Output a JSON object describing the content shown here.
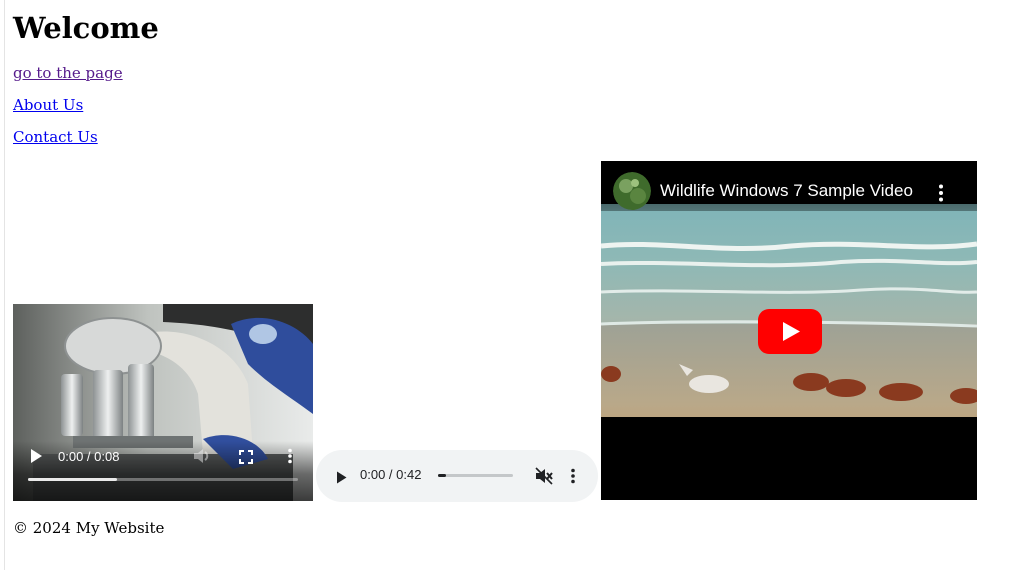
{
  "page": {
    "heading": "Welcome",
    "links": [
      {
        "label": "go to the page",
        "state": "visited"
      },
      {
        "label": "About Us",
        "state": "unvisited"
      },
      {
        "label": "Contact Us",
        "state": "unvisited"
      }
    ],
    "footer": "© 2024 My Website"
  },
  "video_player": {
    "time_display": "0:00 / 0:08",
    "buffered_fraction": 0.33,
    "icons": [
      "play-icon",
      "volume-icon",
      "fullscreen-icon",
      "more-vert-icon"
    ]
  },
  "audio_player": {
    "time_display": "0:00 / 0:42",
    "played_fraction": 0.1,
    "icons": [
      "play-icon",
      "muted-icon",
      "more-vert-icon"
    ]
  },
  "youtube_embed": {
    "video_title": "Wildlife Windows 7 Sample Video",
    "icons": [
      "channel-avatar",
      "more-vert-icon",
      "youtube-play-icon"
    ],
    "colors": {
      "play_button": "#ff0000"
    }
  },
  "colors": {
    "visited_link": "#551a8b",
    "unvisited_link": "#0000ee",
    "audio_bg": "#f1f3f4"
  }
}
